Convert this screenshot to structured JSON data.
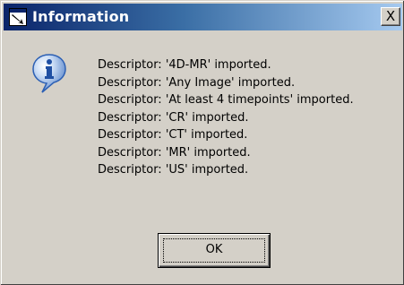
{
  "dialog": {
    "title": "Information",
    "title_icon": "app-window-icon",
    "close_label": "X",
    "message_icon": "info-icon",
    "messages": [
      "Descriptor: '4D-MR' imported.",
      "Descriptor: 'Any Image' imported.",
      "Descriptor: 'At least 4 timepoints' imported.",
      "Descriptor: 'CR' imported.",
      "Descriptor: 'CT' imported.",
      "Descriptor: 'MR' imported.",
      "Descriptor: 'US' imported."
    ],
    "ok_label": "OK"
  },
  "colors": {
    "title_gradient_start": "#0a246a",
    "title_gradient_end": "#a6caf0",
    "face": "#d4d0c8",
    "info_blue": "#2b5fb4"
  }
}
